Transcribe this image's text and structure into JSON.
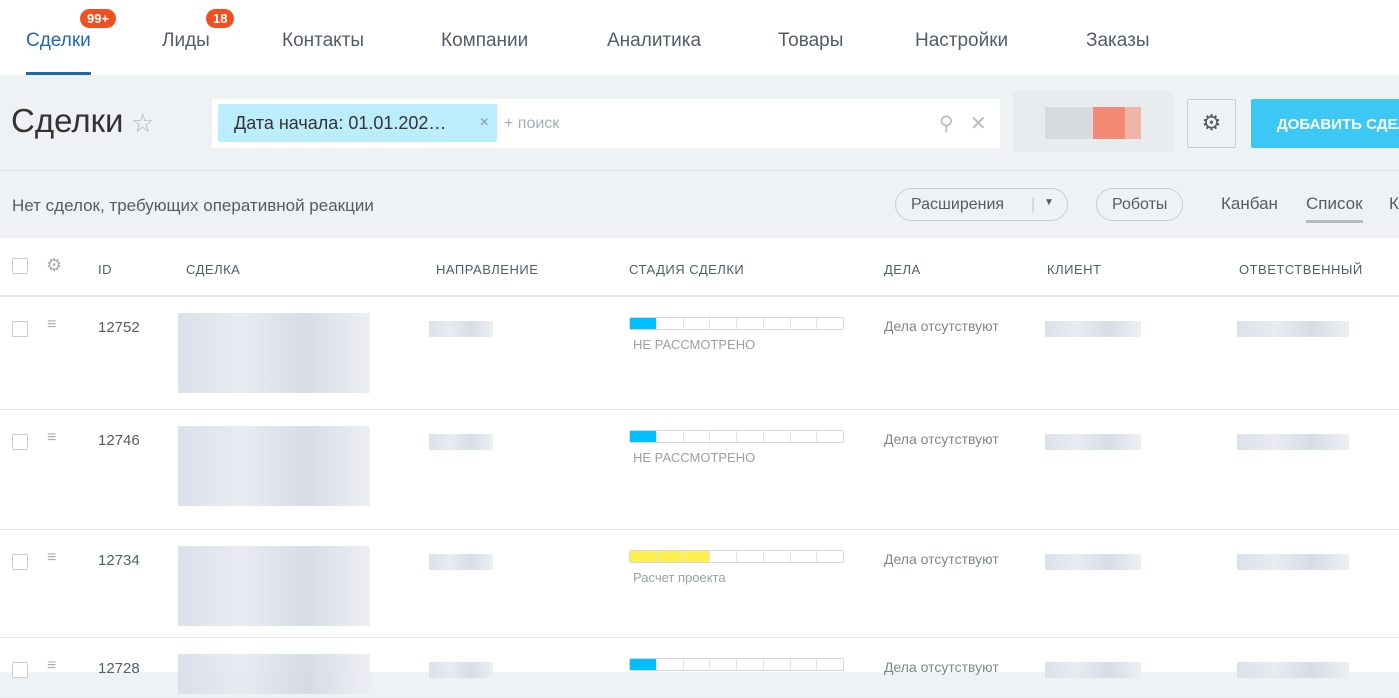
{
  "nav": {
    "tabs": [
      {
        "label": "Сделки",
        "badge": "99+",
        "active": true
      },
      {
        "label": "Лиды",
        "badge": "18"
      },
      {
        "label": "Контакты"
      },
      {
        "label": "Компании"
      },
      {
        "label": "Аналитика"
      },
      {
        "label": "Товары"
      },
      {
        "label": "Настройки"
      },
      {
        "label": "Заказы"
      }
    ]
  },
  "header": {
    "title": "Сделки",
    "filter_chip": "Дата начала: 01.01.202…",
    "search_placeholder": "+ поиск",
    "add_button": "ДОБАВИТЬ СДЕЛКУ"
  },
  "toolbar": {
    "notice": "Нет сделок, требующих оперативной реакции",
    "extensions": "Расширения",
    "robots": "Роботы",
    "views": [
      "Канбан",
      "Список",
      "К"
    ]
  },
  "columns": [
    "ID",
    "СДЕЛКА",
    "НАПРАВЛЕНИЕ",
    "СТАДИЯ СДЕЛКИ",
    "ДЕЛА",
    "КЛИЕНТ",
    "ОТВЕТСТВЕННЫЙ"
  ],
  "rows": [
    {
      "id": "12752",
      "stage": "НЕ РАССМОТРЕНО",
      "stage_filled": 1,
      "stage_color": "#00bfff",
      "activity": "Дела отсутствуют"
    },
    {
      "id": "12746",
      "stage": "НЕ РАССМОТРЕНО",
      "stage_filled": 1,
      "stage_color": "#00bfff",
      "activity": "Дела отсутствуют"
    },
    {
      "id": "12734",
      "stage": "Расчет проекта",
      "stage_filled": 3,
      "stage_color": "#fff04f",
      "activity": "Дела отсутствуют"
    },
    {
      "id": "12728",
      "stage": "",
      "stage_filled": 1,
      "stage_color": "#00bfff",
      "activity": "Дела отсутствуют"
    }
  ],
  "stage_segments": 8,
  "colors": {
    "accent": "#2067b0",
    "badge": "#f0501f",
    "add_button": "#3bc8f5"
  }
}
